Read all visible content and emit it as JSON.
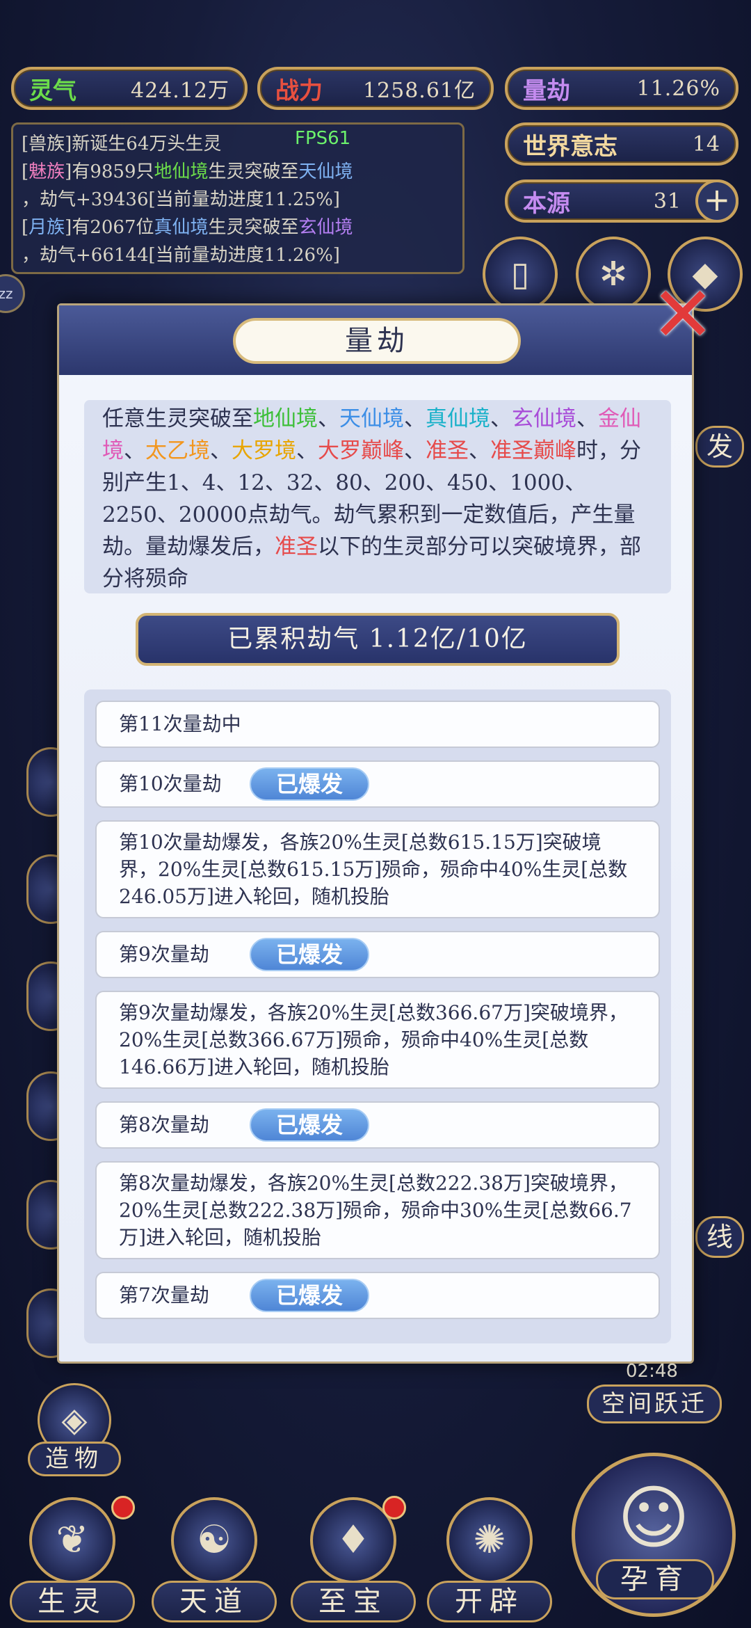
{
  "hud": {
    "lingqi": {
      "label": "灵气",
      "value": "424.12万"
    },
    "zhanli": {
      "label": "战力",
      "value": "1258.61亿"
    },
    "liangjie": {
      "label": "量劫",
      "value": "11.26%"
    },
    "shijie_yizhi": {
      "label": "世界意志",
      "value": "14"
    },
    "benyuan": {
      "label": "本源",
      "value": "31",
      "add": "+"
    }
  },
  "fps": "FPS61",
  "log": {
    "line1": "[兽族]新诞生64万头生灵",
    "line2": {
      "pre": "[",
      "race": "魅族",
      "mid": "]有9859只",
      "from": "地仙境",
      "mid2": "生灵突破至",
      "to": "天仙境"
    },
    "line3": "，劫气+39436[当前量劫进度11.25%]",
    "line4": {
      "pre": "[",
      "race": "月族",
      "mid": "]有2067位",
      "from": "真仙境",
      "mid2": "生灵突破至",
      "to": "玄仙境"
    },
    "line5": "，劫气+66144[当前量劫进度11.26%]"
  },
  "modal": {
    "title": "量劫",
    "close": "✕",
    "desc": {
      "p1": "任意生灵突破至",
      "realms": [
        "地仙境",
        "天仙境",
        "真仙境",
        "玄仙境",
        "金仙境",
        "太乙境",
        "大罗境",
        "大罗巅峰",
        "准圣",
        "准圣巅峰"
      ],
      "sep": "、",
      "p2": "时，分别产生1、4、12、32、80、200、450、1000、2250、20000点劫气。劫气累积到一定数值后，产生量劫。量劫爆发后，",
      "zhunsheng": "准圣",
      "p3": "以下的生灵部分可以突破境界，部分将殒命"
    },
    "accumulated": "已累积劫气 1.12亿/10亿",
    "entries": [
      {
        "title": "第11次量劫中",
        "badge": "",
        "detail": ""
      },
      {
        "title": "第10次量劫",
        "badge": "已爆发",
        "detail": "第10次量劫爆发，各族20%生灵[总数615.15万]突破境界，20%生灵[总数615.15万]殒命，殒命中40%生灵[总数246.05万]进入轮回，随机投胎"
      },
      {
        "title": "第9次量劫",
        "badge": "已爆发",
        "detail": "第9次量劫爆发，各族20%生灵[总数366.67万]突破境界，20%生灵[总数366.67万]殒命，殒命中40%生灵[总数146.66万]进入轮回，随机投胎"
      },
      {
        "title": "第8次量劫",
        "badge": "已爆发",
        "detail": "第8次量劫爆发，各族20%生灵[总数222.38万]突破境界，20%生灵[总数222.38万]殒命，殒命中30%生灵[总数66.7万]进入轮回，随机投胎"
      },
      {
        "title": "第7次量劫",
        "badge": "已爆发",
        "detail": ""
      }
    ]
  },
  "side": {
    "fa": "发",
    "xian": "线",
    "timer": "02:48",
    "space_jump": "空间跃迁",
    "zaowu": "造物"
  },
  "nav": [
    {
      "label": "生灵",
      "icon": "❦"
    },
    {
      "label": "天道",
      "icon": "☯"
    },
    {
      "label": "至宝",
      "icon": "♦"
    },
    {
      "label": "开辟",
      "icon": "✺"
    }
  ],
  "yunyu": {
    "label": "孕育",
    "icon": "☺"
  },
  "colors": {
    "gold": "#c9a25c",
    "navy": "#1b2247",
    "badge": "#5c8fdc"
  }
}
